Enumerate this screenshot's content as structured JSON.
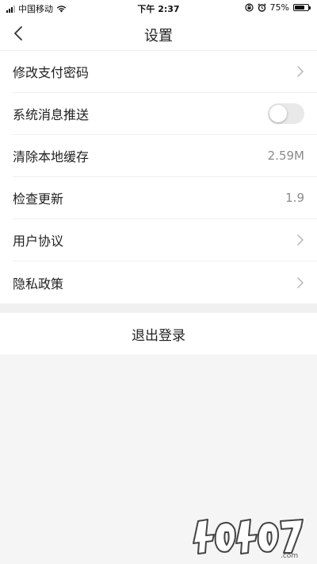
{
  "status_bar": {
    "carrier": "中国移动",
    "time": "下午 2:37",
    "battery_text": "75%",
    "battery_level": 0.75
  },
  "nav": {
    "title": "设置"
  },
  "settings": [
    {
      "label": "修改支付密码"
    },
    {
      "label": "系统消息推送",
      "toggle_on": false
    },
    {
      "label": "清除本地缓存",
      "value": "2.59M"
    },
    {
      "label": "检查更新",
      "value": "1.9"
    },
    {
      "label": "用户协议"
    },
    {
      "label": "隐私政策"
    }
  ],
  "logout_label": "退出登录",
  "watermark_text": "4O4O7.com",
  "icons": [
    "signal-icon",
    "wifi-icon",
    "orientation-lock-icon",
    "alarm-icon",
    "battery-icon",
    "back-arrow-icon",
    "chevron-right-icon"
  ]
}
